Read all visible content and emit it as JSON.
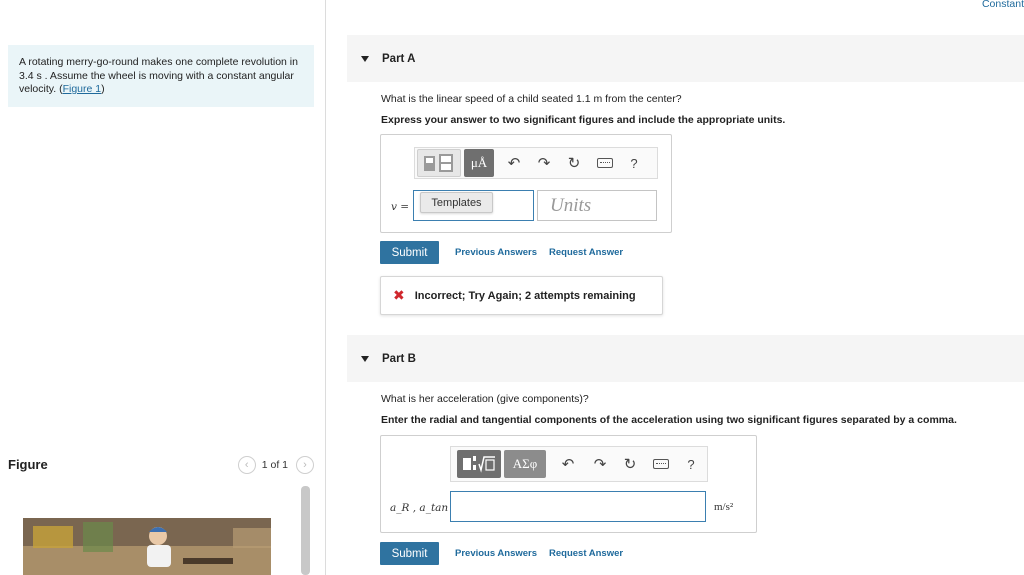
{
  "constants_link": "Constant",
  "problem": {
    "text": "A rotating merry-go-round makes one complete revolution in 3.4 s . Assume the wheel is moving with a constant angular velocity. (",
    "figure_link": "Figure 1",
    "close_paren": ")"
  },
  "figure": {
    "title": "Figure",
    "pager_text": "1 of 1",
    "prev_icon": "chevron-left-icon",
    "next_icon": "chevron-right-icon"
  },
  "part_a": {
    "title": "Part A",
    "question": "What is the linear speed of a child seated 1.1 m from the center?",
    "instruction": "Express your answer to two significant figures and include the appropriate units.",
    "toolbar": {
      "mu_label": "μÅ",
      "help": "?"
    },
    "var_label": "v =",
    "tooltip": "Templates",
    "value": "",
    "units_placeholder": "Units",
    "submit": "Submit",
    "previous_answers": "Previous Answers",
    "request_answer": "Request Answer",
    "feedback": "Incorrect; Try Again; 2 attempts remaining",
    "feedback_color": "#d0272d"
  },
  "part_b": {
    "title": "Part B",
    "question": "What is her acceleration (give components)?",
    "instruction": "Enter the radial and tangential components of the acceleration using two significant figures separated by a comma.",
    "toolbar": {
      "greek_label": "ΑΣφ",
      "help": "?"
    },
    "var_label": "a_R , a_tan =",
    "value": "",
    "unit": "m/s²",
    "submit": "Submit",
    "previous_answers": "Previous Answers",
    "request_answer": "Request Answer"
  },
  "colors": {
    "accent": "#2f73a0",
    "link": "#1f6a9c",
    "problem_bg": "#eaf5f8"
  }
}
